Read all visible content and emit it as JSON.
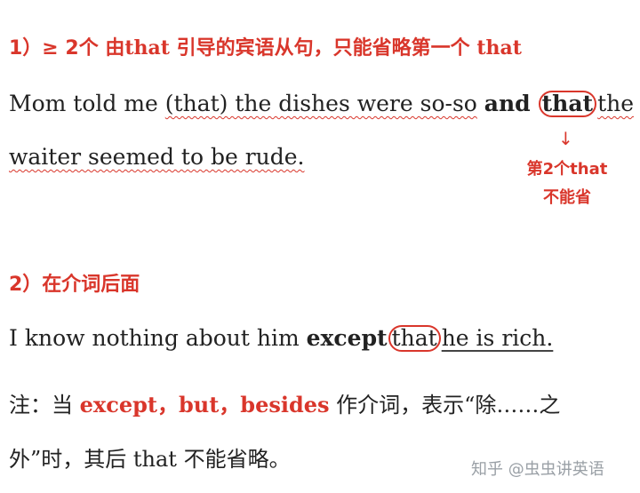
{
  "section1": {
    "number": "1）≥ 2个",
    "title_mid": "由that",
    "title_rest": "引导的宾语从句，只能省略第一个",
    "title_that": "that"
  },
  "sentence1": {
    "p1": "Mom told me ",
    "p2": "(that) the dishes were so-so",
    "p3": " ",
    "and": "and",
    "that": "that",
    "the": "the",
    "line2": "waiter seemed to be rude."
  },
  "note1": {
    "arrow": "↓",
    "line1": "第2个that",
    "line2": "不能省"
  },
  "section2": {
    "title": "2）在介词后面"
  },
  "sentence2": {
    "p1": "I know nothing about him ",
    "except": "except",
    "that": "that",
    "rest": "he is rich."
  },
  "note2": {
    "prefix": "注：当 ",
    "red": "except，but，besides",
    "suffix": " 作介词，表示“除……之",
    "line2": "外”时，其后 that 不能省略。"
  },
  "watermark": "知乎 @虫虫讲英语"
}
